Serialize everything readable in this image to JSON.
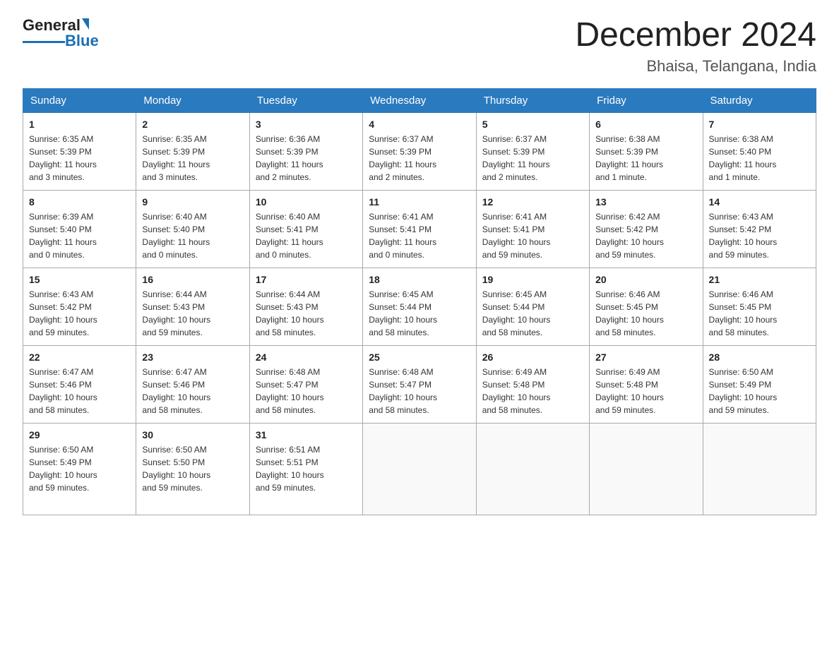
{
  "header": {
    "logo_text_black": "General",
    "logo_text_blue": "Blue",
    "month_title": "December 2024",
    "location": "Bhaisa, Telangana, India"
  },
  "columns": [
    "Sunday",
    "Monday",
    "Tuesday",
    "Wednesday",
    "Thursday",
    "Friday",
    "Saturday"
  ],
  "weeks": [
    [
      {
        "day": "1",
        "info": "Sunrise: 6:35 AM\nSunset: 5:39 PM\nDaylight: 11 hours\nand 3 minutes."
      },
      {
        "day": "2",
        "info": "Sunrise: 6:35 AM\nSunset: 5:39 PM\nDaylight: 11 hours\nand 3 minutes."
      },
      {
        "day": "3",
        "info": "Sunrise: 6:36 AM\nSunset: 5:39 PM\nDaylight: 11 hours\nand 2 minutes."
      },
      {
        "day": "4",
        "info": "Sunrise: 6:37 AM\nSunset: 5:39 PM\nDaylight: 11 hours\nand 2 minutes."
      },
      {
        "day": "5",
        "info": "Sunrise: 6:37 AM\nSunset: 5:39 PM\nDaylight: 11 hours\nand 2 minutes."
      },
      {
        "day": "6",
        "info": "Sunrise: 6:38 AM\nSunset: 5:39 PM\nDaylight: 11 hours\nand 1 minute."
      },
      {
        "day": "7",
        "info": "Sunrise: 6:38 AM\nSunset: 5:40 PM\nDaylight: 11 hours\nand 1 minute."
      }
    ],
    [
      {
        "day": "8",
        "info": "Sunrise: 6:39 AM\nSunset: 5:40 PM\nDaylight: 11 hours\nand 0 minutes."
      },
      {
        "day": "9",
        "info": "Sunrise: 6:40 AM\nSunset: 5:40 PM\nDaylight: 11 hours\nand 0 minutes."
      },
      {
        "day": "10",
        "info": "Sunrise: 6:40 AM\nSunset: 5:41 PM\nDaylight: 11 hours\nand 0 minutes."
      },
      {
        "day": "11",
        "info": "Sunrise: 6:41 AM\nSunset: 5:41 PM\nDaylight: 11 hours\nand 0 minutes."
      },
      {
        "day": "12",
        "info": "Sunrise: 6:41 AM\nSunset: 5:41 PM\nDaylight: 10 hours\nand 59 minutes."
      },
      {
        "day": "13",
        "info": "Sunrise: 6:42 AM\nSunset: 5:42 PM\nDaylight: 10 hours\nand 59 minutes."
      },
      {
        "day": "14",
        "info": "Sunrise: 6:43 AM\nSunset: 5:42 PM\nDaylight: 10 hours\nand 59 minutes."
      }
    ],
    [
      {
        "day": "15",
        "info": "Sunrise: 6:43 AM\nSunset: 5:42 PM\nDaylight: 10 hours\nand 59 minutes."
      },
      {
        "day": "16",
        "info": "Sunrise: 6:44 AM\nSunset: 5:43 PM\nDaylight: 10 hours\nand 59 minutes."
      },
      {
        "day": "17",
        "info": "Sunrise: 6:44 AM\nSunset: 5:43 PM\nDaylight: 10 hours\nand 58 minutes."
      },
      {
        "day": "18",
        "info": "Sunrise: 6:45 AM\nSunset: 5:44 PM\nDaylight: 10 hours\nand 58 minutes."
      },
      {
        "day": "19",
        "info": "Sunrise: 6:45 AM\nSunset: 5:44 PM\nDaylight: 10 hours\nand 58 minutes."
      },
      {
        "day": "20",
        "info": "Sunrise: 6:46 AM\nSunset: 5:45 PM\nDaylight: 10 hours\nand 58 minutes."
      },
      {
        "day": "21",
        "info": "Sunrise: 6:46 AM\nSunset: 5:45 PM\nDaylight: 10 hours\nand 58 minutes."
      }
    ],
    [
      {
        "day": "22",
        "info": "Sunrise: 6:47 AM\nSunset: 5:46 PM\nDaylight: 10 hours\nand 58 minutes."
      },
      {
        "day": "23",
        "info": "Sunrise: 6:47 AM\nSunset: 5:46 PM\nDaylight: 10 hours\nand 58 minutes."
      },
      {
        "day": "24",
        "info": "Sunrise: 6:48 AM\nSunset: 5:47 PM\nDaylight: 10 hours\nand 58 minutes."
      },
      {
        "day": "25",
        "info": "Sunrise: 6:48 AM\nSunset: 5:47 PM\nDaylight: 10 hours\nand 58 minutes."
      },
      {
        "day": "26",
        "info": "Sunrise: 6:49 AM\nSunset: 5:48 PM\nDaylight: 10 hours\nand 58 minutes."
      },
      {
        "day": "27",
        "info": "Sunrise: 6:49 AM\nSunset: 5:48 PM\nDaylight: 10 hours\nand 59 minutes."
      },
      {
        "day": "28",
        "info": "Sunrise: 6:50 AM\nSunset: 5:49 PM\nDaylight: 10 hours\nand 59 minutes."
      }
    ],
    [
      {
        "day": "29",
        "info": "Sunrise: 6:50 AM\nSunset: 5:49 PM\nDaylight: 10 hours\nand 59 minutes."
      },
      {
        "day": "30",
        "info": "Sunrise: 6:50 AM\nSunset: 5:50 PM\nDaylight: 10 hours\nand 59 minutes."
      },
      {
        "day": "31",
        "info": "Sunrise: 6:51 AM\nSunset: 5:51 PM\nDaylight: 10 hours\nand 59 minutes."
      },
      {
        "day": "",
        "info": ""
      },
      {
        "day": "",
        "info": ""
      },
      {
        "day": "",
        "info": ""
      },
      {
        "day": "",
        "info": ""
      }
    ]
  ]
}
